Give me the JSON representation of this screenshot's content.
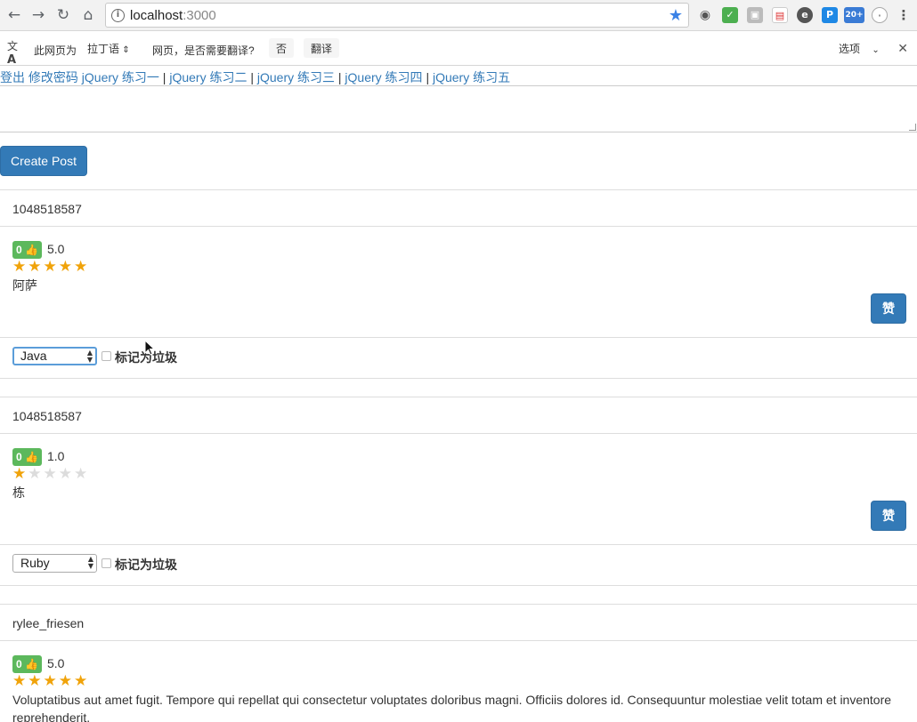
{
  "browser": {
    "url_host": "localhost",
    "url_port": ":3000",
    "ext_badge": "20+"
  },
  "translate_bar": {
    "prefix": "此网页为",
    "language": "拉丁语",
    "question": "网页，是否需要翻译?",
    "no": "否",
    "translate": "翻译",
    "options": "选项"
  },
  "nav_links": [
    "登出",
    "修改密码",
    "jQuery 练习一",
    "jQuery 练习二",
    "jQuery 练习三",
    "jQuery 练习四",
    "jQuery 练习五"
  ],
  "create_post_label": "Create Post",
  "posts": [
    {
      "author": "1048518587",
      "likes": "0",
      "rating": "5.0",
      "stars_filled": 5,
      "content": "阿萨",
      "like_label": "赞",
      "category": "Java",
      "spam_label": "标记为垃圾"
    },
    {
      "author": "1048518587",
      "likes": "0",
      "rating": "1.0",
      "stars_filled": 1,
      "content": "栋",
      "like_label": "赞",
      "category": "Ruby",
      "spam_label": "标记为垃圾"
    },
    {
      "author": "rylee_friesen",
      "likes": "0",
      "rating": "5.0",
      "stars_filled": 5,
      "content": "Voluptatibus aut amet fugit. Tempore qui repellat qui consectetur voluptates doloribus magni. Officiis dolores id. Consequuntur molestiae velit totam et inventore reprehenderit."
    }
  ]
}
